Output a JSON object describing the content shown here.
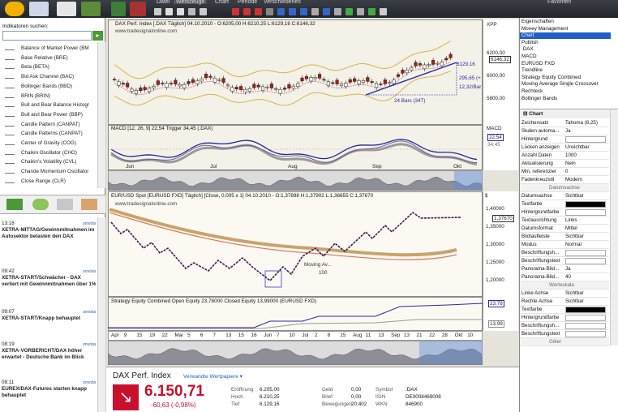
{
  "toolbar": {
    "menu": [
      "Datei",
      "Werkzeuge",
      "Chart",
      "Periode",
      "Verschiedenes"
    ],
    "favoriten": "Favoriten"
  },
  "left_panel": {
    "search_label": "Indikatoren suchen:",
    "indicators": [
      "Balance of Market Power (BM",
      "Base Relative (BRE)",
      "Beta (BETA)",
      "Bid Ask Channel (BAC)",
      "Bollinger Bands (BBD)",
      "BRIN (BRIN)",
      "Bull and Bear Balance Histogr",
      "Bull and Bear Power (BBP)",
      "Candle Pattern (CANPAT)",
      "Candle Patterns (CANPAT)",
      "Center of Gravity (COG)",
      "Chaikin Oscillator (CHO)",
      "Chaikin's Volatility (CVL)",
      "Chande Momentum Oscillator",
      "Close Range (CLR)"
    ],
    "news": [
      {
        "time": "13:18",
        "source": "onvista",
        "headline": "XETRA-MITTAG/Gewinnmitnahmen im Autosektor belasten den DAX"
      },
      {
        "time": "09:42",
        "source": "onvista",
        "headline": "XETRA-START/Schwächer - DAX verliert mit Gewinnmitnahmen über 1%"
      },
      {
        "time": "09:07",
        "source": "onvista",
        "headline": "XETRA-START/Knapp behauptet"
      },
      {
        "time": "08:19",
        "source": "onvista",
        "headline": "XETRA-VORBERICHT/DAX höher erwartet - Deutsche Bank im Blick"
      },
      {
        "time": "08:11",
        "source": "onvista",
        "headline": "EUREX/DAX-Futures starten knapp behauptet"
      }
    ]
  },
  "chart1": {
    "header": "DAX Perf. Index [.DAX Täglich] 04.10.2010 - O:6205,00 H:6210,25 L:6129,16 C:6146,32",
    "watermark": "www.tradesignalonline.com",
    "axis_title": "XPP",
    "y_ticks": [
      "6200,00",
      "6000,00",
      "5800,00"
    ],
    "last_price": "6146,32",
    "annotation_price": "6129,16",
    "annotation_change": "295,65 (+",
    "annotation_pct": "12,32/Bar",
    "bars_label": "24 Bars (34T)"
  },
  "chart_macd": {
    "header": "MACD [12, 26, 9] 22,54 Trigger 34,45 (.DAX)",
    "axis_title": "MACD",
    "value1": "22,54",
    "value2": "34,45",
    "months": [
      "Jun",
      "Jul",
      "Aug",
      "Sep",
      "Okt"
    ]
  },
  "chart2": {
    "header": "EUR/USD Spot [EURUSD FXD] Täglich] [Close, 0,005 x 1] 04.10.2010 - O:1,37898 H:1,37902 L:1,36655 C:1,37670",
    "watermark": "www.tradesignalonline.com",
    "axis_title": "$",
    "y_ticks": [
      "1,40000",
      "1,35000",
      "1,30000",
      "1,25000",
      "1,20000"
    ],
    "last_price": "1,37670",
    "annotation": "Moving Av...",
    "annotation_value": "100"
  },
  "chart_strategy": {
    "header": "Strategy Equity Combined Open Equity 23,78000 Closed Equity 13,99000 (EURUSD FXD)",
    "value1": "23,78",
    "value2": "13,99",
    "x_labels": [
      "Apr",
      "9",
      "15",
      "19",
      "22",
      "Mai",
      "5",
      "6",
      "7",
      "13",
      "15",
      "16",
      "Jun",
      "7",
      "10",
      "Jul",
      "2",
      "8",
      "15",
      "Aug",
      "11",
      "13",
      "Sep",
      "13",
      "21",
      "22",
      "28",
      "Okt",
      "10"
    ]
  },
  "properties": {
    "tree": [
      "Eigenschaften",
      "Money Management",
      "Chart",
      "Publish",
      ".DAX",
      "MACD",
      "EURUSD FXD",
      "Trendline",
      "Strategy Equity Combined",
      "Moving Average Single Crossover",
      "Rechteck",
      "Bollinger Bands"
    ],
    "selected": "Chart",
    "section": "Chart",
    "rows": [
      {
        "k": "Zeichensatz",
        "v": "Tahoma (8,25)"
      },
      {
        "k": "Skalen automa...",
        "v": "Ja"
      },
      {
        "k": "Hintergrund",
        "v": ""
      },
      {
        "k": "Lücken anzeigen",
        "v": "Unsichtbar"
      },
      {
        "k": "Anzahl Daten",
        "v": "1000"
      },
      {
        "k": "Aktualisierung",
        "v": "Nein"
      },
      {
        "k": "Min. referenzier",
        "v": "0"
      },
      {
        "k": "Fadenkreuzstil",
        "v": "Modern"
      },
      {
        "k": "Datumsachse",
        "v": "",
        "group": true
      },
      {
        "k": "Datumsachse",
        "v": "Sichtbar"
      },
      {
        "k": "Textfarbe",
        "v": ""
      },
      {
        "k": "Hintergrundfarbe",
        "v": ""
      },
      {
        "k": "Textausrichtung",
        "v": "Links"
      },
      {
        "k": "Datumsformat",
        "v": "Mittel"
      },
      {
        "k": "Bildlaufleiste",
        "v": "Sichtbar"
      },
      {
        "k": "Modus",
        "v": "Normal"
      },
      {
        "k": "Beschriftungsh...",
        "v": ""
      },
      {
        "k": "Beschriftungstext",
        "v": ""
      },
      {
        "k": "Panorama-Bild...",
        "v": "Ja"
      },
      {
        "k": "Panorama-Bild...",
        "v": "40"
      },
      {
        "k": "Werteskala",
        "v": "",
        "group": true
      },
      {
        "k": "Linke Achse",
        "v": "Sichtbar"
      },
      {
        "k": "Rechte Achse",
        "v": "Sichtbar"
      },
      {
        "k": "Textfarbe",
        "v": ""
      },
      {
        "k": "Hintergrundfarbe",
        "v": ""
      },
      {
        "k": "Beschriftungsh...",
        "v": ""
      },
      {
        "k": "Beschriftungstext",
        "v": ""
      },
      {
        "k": "Gitter",
        "v": "",
        "group": true
      }
    ]
  },
  "quote": {
    "name": "DAX Perf. Index",
    "related": "Verwandte Wertpapiere ▾",
    "price": "6.150,71",
    "change": "-60,63 (-0,98%)",
    "col1": [
      {
        "k": "Eröffnung",
        "v": "6.205,00"
      },
      {
        "k": "Hoch",
        "v": "6.210,25"
      },
      {
        "k": "Tief",
        "v": "6.129,16"
      }
    ],
    "col2": [
      {
        "k": "Geld",
        "v": "0,00"
      },
      {
        "k": "Brief",
        "v": "0,00"
      },
      {
        "k": "Bewegungen",
        "v": "20.402"
      }
    ],
    "col3": [
      {
        "k": "Symbol",
        "v": ".DAX"
      },
      {
        "k": "ISIN",
        "v": "DE0008469008"
      },
      {
        "k": "WKN",
        "v": "846900"
      }
    ]
  },
  "colors": {
    "accent": "#1f5fc8",
    "down": "#c8102e",
    "up": "#2e7d32"
  }
}
